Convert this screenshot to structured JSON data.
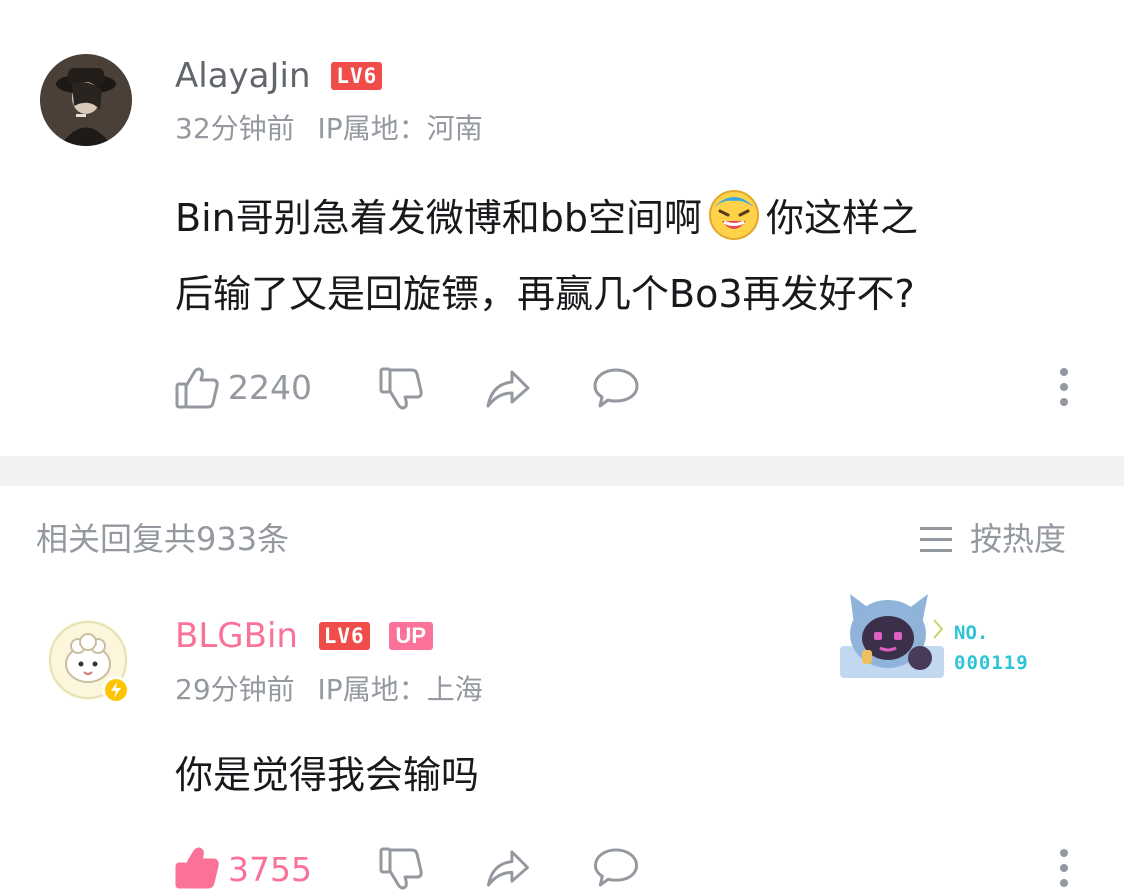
{
  "comment": {
    "username": "AlayaJin",
    "level": "LV6",
    "time": "32分钟前",
    "ip": "IP属地：河南",
    "text_line1": "Bin哥别急着发微博和bb空间啊",
    "text_line1_tail": "你这样之",
    "text_line2": "后输了又是回旋镖，再赢几个Bo3再发好不?",
    "likes": "2240"
  },
  "replies_header": {
    "count_label": "相关回复共933条",
    "sort_label": "按热度"
  },
  "reply": {
    "username": "BLGBin",
    "level": "LV6",
    "up_badge": "UP",
    "time": "29分钟前",
    "ip": "IP属地：上海",
    "text": "你是觉得我会输吗",
    "likes": "3755",
    "badge_no_label": "NO.",
    "badge_number": "000119"
  },
  "icons": [
    "thumbs-up-icon",
    "thumbs-down-icon",
    "share-icon",
    "comment-icon",
    "more-icon",
    "sort-icon",
    "laughing-emoji-icon"
  ],
  "colors": {
    "vip_pink": "#fb7299",
    "level_red": "#f04c49",
    "gray": "#9499a0",
    "badge_cyan": "#2ec4d6"
  }
}
